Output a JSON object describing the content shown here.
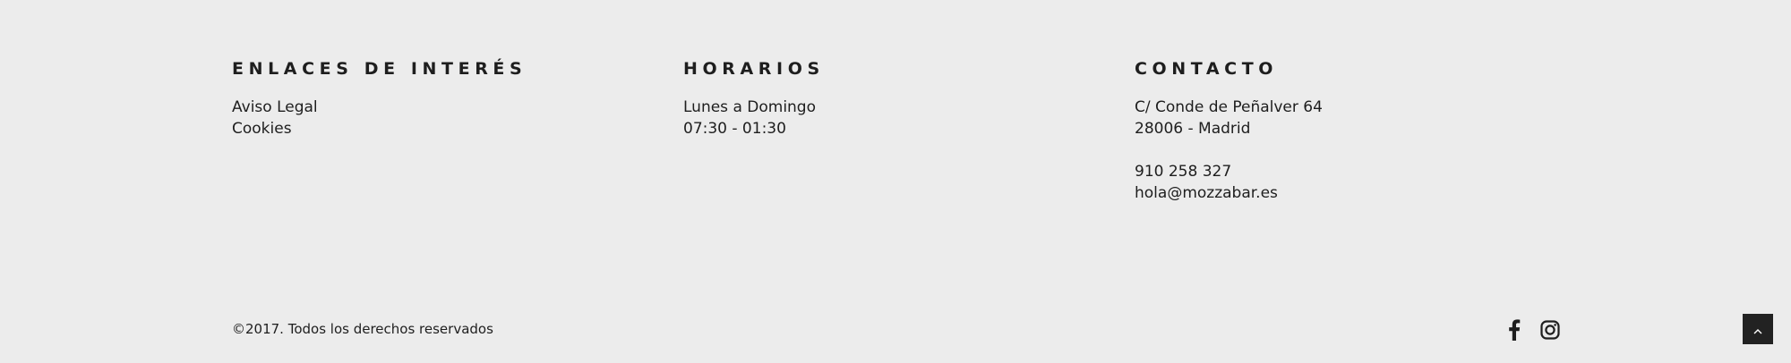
{
  "footer": {
    "links": {
      "heading": "ENLACES DE INTERÉS",
      "items": [
        {
          "label": "Aviso Legal"
        },
        {
          "label": "Cookies"
        }
      ]
    },
    "hours": {
      "heading": "HORARIOS",
      "days": "Lunes a Domingo",
      "time": "07:30 - 01:30"
    },
    "contact": {
      "heading": "CONTACTO",
      "street": "C/ Conde de Peñalver 64",
      "city": "28006 - Madrid",
      "phone": "910 258 327",
      "email": "hola@mozzabar.es"
    },
    "copyright": "©2017. Todos los derechos reservados",
    "social": [
      {
        "icon": "facebook-icon"
      },
      {
        "icon": "instagram-icon"
      }
    ],
    "back_to_top_icon": "chevron-up-icon",
    "colors": {
      "background": "#ececec",
      "text": "#1e1e1e",
      "button": "#222222"
    }
  }
}
